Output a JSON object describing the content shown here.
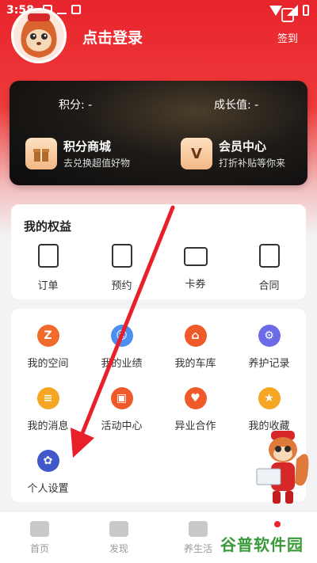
{
  "status_bar": {
    "time": "3:58"
  },
  "header": {
    "login_text": "点击登录",
    "signin_label": "签到"
  },
  "member_card": {
    "points_label": "积分: -",
    "growth_label": "成长值: -",
    "mall": {
      "title": "积分商城",
      "subtitle": "去兑换超值好物"
    },
    "member_center": {
      "title": "会员中心",
      "subtitle": "打折补贴等你来",
      "icon_text": "V"
    }
  },
  "rights": {
    "title": "我的权益",
    "items": [
      {
        "label": "订单",
        "icon": "order-icon"
      },
      {
        "label": "预约",
        "icon": "appointment-icon"
      },
      {
        "label": "卡券",
        "icon": "coupon-icon"
      },
      {
        "label": "合同",
        "icon": "contract-icon"
      }
    ]
  },
  "services": {
    "items": [
      {
        "label": "我的空间",
        "icon": "space-icon",
        "color": "#f06a2a",
        "glyph": "Z"
      },
      {
        "label": "我的业绩",
        "icon": "performance-icon",
        "color": "#4d8ff0",
        "glyph": "☺"
      },
      {
        "label": "我的车库",
        "icon": "garage-icon",
        "color": "#f05a2a",
        "glyph": "⌂"
      },
      {
        "label": "养护记录",
        "icon": "maintenance-icon",
        "color": "#6b6be8",
        "glyph": "⚙"
      },
      {
        "label": "我的消息",
        "icon": "message-icon",
        "color": "#f5a623",
        "glyph": "≡"
      },
      {
        "label": "活动中心",
        "icon": "activity-icon",
        "color": "#f05a2a",
        "glyph": "▣"
      },
      {
        "label": "异业合作",
        "icon": "cooperation-icon",
        "color": "#f05a2a",
        "glyph": "♥"
      },
      {
        "label": "我的收藏",
        "icon": "favorite-icon",
        "color": "#f5a623",
        "glyph": "★"
      },
      {
        "label": "个人设置",
        "icon": "settings-icon",
        "color": "#4257c8",
        "glyph": "✿"
      }
    ]
  },
  "bottom_nav": {
    "items": [
      {
        "label": "首页",
        "icon": "car-icon"
      },
      {
        "label": "发现",
        "icon": "discover-icon"
      },
      {
        "label": "养生活",
        "icon": "life-icon"
      },
      {
        "label": "",
        "icon": "mine-icon"
      }
    ]
  },
  "watermark": "谷普软件园",
  "colors": {
    "brand_red": "#e8242c",
    "arrow_red": "#e8202a"
  }
}
